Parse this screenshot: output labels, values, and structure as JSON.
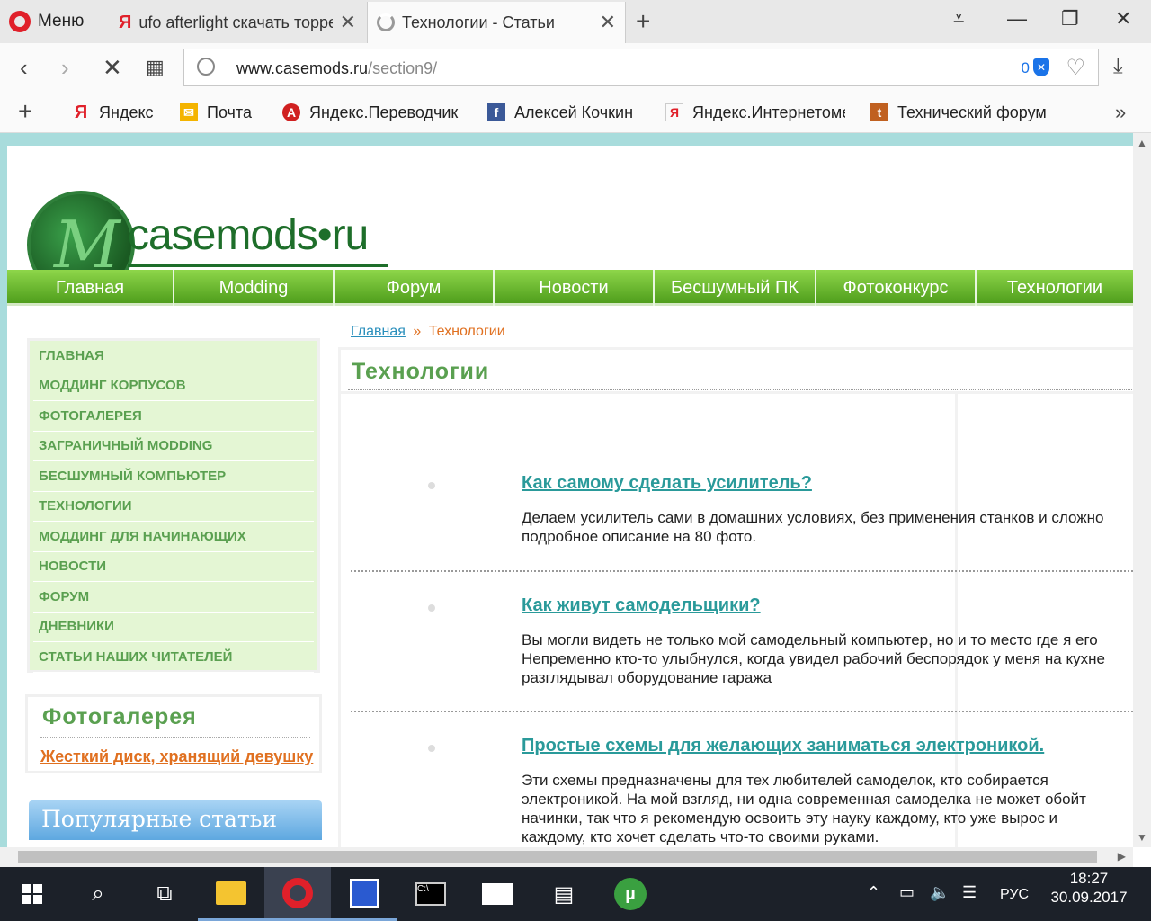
{
  "browser": {
    "menu_label": "Меню",
    "tabs": [
      {
        "title": "ufo afterlight скачать торрент"
      },
      {
        "title": "Технологии - Статьи"
      }
    ],
    "url_host": "www.casemods.ru",
    "url_path": "/section9/",
    "blocked_count": "0",
    "bookmarks": [
      {
        "label": "Яндекс",
        "icon": "yandex-icon",
        "color": "#e0202a"
      },
      {
        "label": "Почта",
        "icon": "mail-icon",
        "color": "#f4b400"
      },
      {
        "label": "Яндекс.Переводчик",
        "icon": "translate-icon",
        "color": "#d02020"
      },
      {
        "label": "Алексей Кочкин",
        "icon": "facebook-icon",
        "color": "#3b5998"
      },
      {
        "label": "Яндекс.Интернетометр",
        "icon": "yandex-icon",
        "color": "#e0202a"
      },
      {
        "label": "Технический форум",
        "icon": "forum-icon",
        "color": "#c06020"
      }
    ]
  },
  "site": {
    "logo_text": "casemods•ru",
    "logo_letter": "M",
    "nav": [
      "Главная",
      "Modding",
      "Форум",
      "Новости",
      "Бесшумный ПК",
      "Фотоконкурс",
      "Технологии"
    ],
    "sidebar": [
      "ГЛАВНАЯ",
      "МОДДИНГ КОРПУСОВ",
      "ФОТОГАЛЕРЕЯ",
      "ЗАГРАНИЧНЫЙ MODDING",
      "БЕСШУМНЫЙ КОМПЬЮТЕР",
      "ТЕХНОЛОГИИ",
      "МОДДИНГ ДЛЯ НАЧИНАЮЩИХ",
      "НОВОСТИ",
      "ФОРУМ",
      "ДНЕВНИКИ",
      "СТАТЬИ НАШИХ ЧИТАТЕЛЕЙ"
    ],
    "photogallery": {
      "title": "Фотогалерея",
      "link": "Жесткий диск, хранящий девушку"
    },
    "popular_title": "Популярные статьи",
    "breadcrumb": {
      "home": "Главная",
      "sep": "»",
      "current": "Технологии"
    },
    "page_title": "Технологии",
    "articles": [
      {
        "title": "Как самому сделать усилитель?",
        "desc": "Делаем усилитель сами в домашних условиях, без применения станков и сложно\nподробное описание на 80 фото."
      },
      {
        "title": "Как живут самодельщики?",
        "desc": "Вы могли видеть не только мой самодельный компьютер, но и то место где я его\nНепременно кто-то улыбнулся, когда увидел рабочий беспорядок у меня на кухне\nразглядывал оборудование гаража"
      },
      {
        "title": "Простые схемы для желающих заниматься электроникой.",
        "desc": "Эти схемы предназначены для тех любителей самоделок, кто собирается\nэлектроникой. На мой взгляд, ни одна современная самоделка не может обойт\nначинки, так что я рекомендую освоить эту науку каждому, кто уже вырос и\nкаждому, кто хочет сделать что-то своими руками."
      }
    ]
  },
  "taskbar": {
    "lang": "РУС",
    "time": "18:27",
    "date": "30.09.2017"
  }
}
